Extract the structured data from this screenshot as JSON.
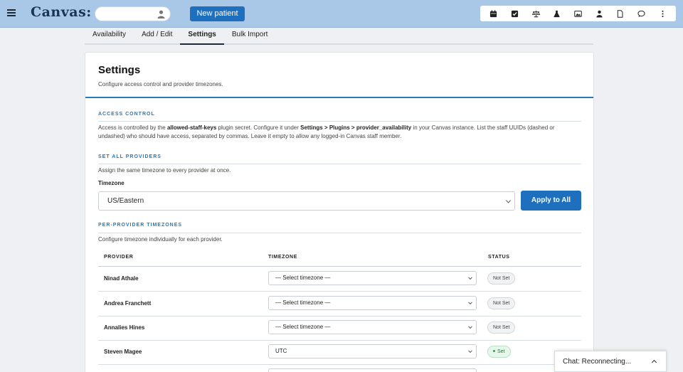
{
  "app": {
    "logo": "Canvas:"
  },
  "header": {
    "new_patient_label": "New patient",
    "toolbar_icons": [
      "calendar-icon",
      "checkbox-icon",
      "scale-icon",
      "flask-icon",
      "image-icon",
      "user-icon",
      "document-icon",
      "chat-icon",
      "more-icon"
    ]
  },
  "tabs": [
    {
      "label": "Availability",
      "active": false
    },
    {
      "label": "Add / Edit",
      "active": false
    },
    {
      "label": "Settings",
      "active": true
    },
    {
      "label": "Bulk Import",
      "active": false
    }
  ],
  "settings": {
    "title": "Settings",
    "subtitle": "Configure access control and provider timezones.",
    "access": {
      "label": "ACCESS CONTROL",
      "text_1": "Access is controlled by the ",
      "key": "allowed-staff-keys",
      "text_2": " plugin secret. Configure it under ",
      "path": "Settings > Plugins > provider_availability",
      "text_3": " in your Canvas instance. List the staff UUIDs (dashed or undashed) who should have access, separated by commas. Leave it empty to allow any logged-in Canvas staff member."
    },
    "set_all": {
      "label": "SET ALL PROVIDERS",
      "text": "Assign the same timezone to every provider at once.",
      "field_label": "Timezone",
      "selected": "US/Eastern",
      "apply_label": "Apply to All"
    },
    "per_provider": {
      "label": "PER-PROVIDER TIMEZONES",
      "text": "Configure timezone individually for each provider.",
      "columns": [
        "PROVIDER",
        "TIMEZONE",
        "STATUS"
      ],
      "rows": [
        {
          "provider": "Ninad Athale",
          "timezone": "— Select timezone —",
          "status": "Not Set"
        },
        {
          "provider": "Andrea Franchett",
          "timezone": "— Select timezone —",
          "status": "Not Set"
        },
        {
          "provider": "Annalies Hines",
          "timezone": "— Select timezone —",
          "status": "Not Set"
        },
        {
          "provider": "Steven Magee",
          "timezone": "UTC",
          "status": "Set"
        }
      ]
    }
  },
  "chat": {
    "label": "Chat: Reconnecting..."
  },
  "colors": {
    "topbar": "#a9c8e8",
    "primary": "#1f6fbf",
    "accent": "#2a79b8",
    "set_green": "#1f7a3a"
  }
}
